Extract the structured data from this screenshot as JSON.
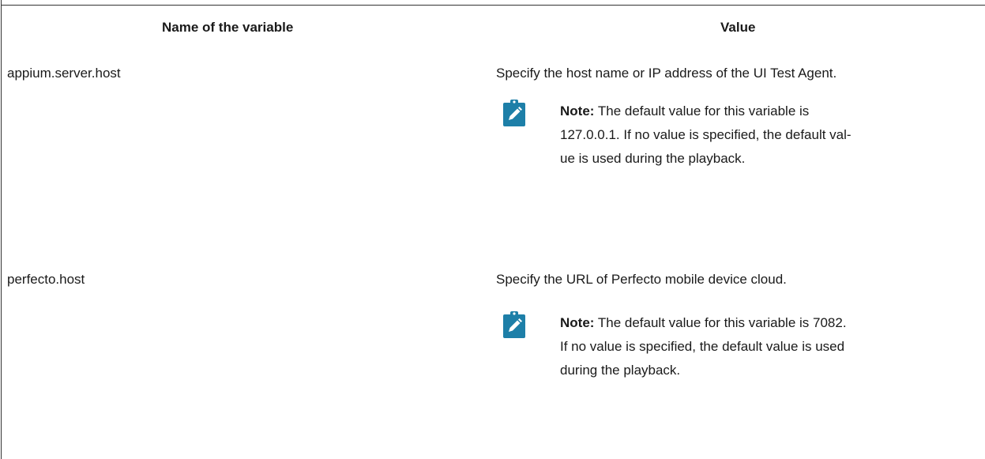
{
  "table": {
    "headers": {
      "name": "Name of the variable",
      "value": "Value"
    },
    "rows": [
      {
        "name": "appium.server.host",
        "value": "Specify the host name or IP address of the UI Test Agent.",
        "note": {
          "label": "Note:",
          "lines": [
            "The default value for this variable is",
            "127.0.0.1. If no value is specified, the default val-",
            "ue is used during the playback."
          ]
        }
      },
      {
        "name": "perfecto.host",
        "value": "Specify the URL of Perfecto mobile device cloud.",
        "note": {
          "label": "Note:",
          "lines": [
            "The default value for this variable is 7082.",
            "If no value is specified, the default value is used",
            "during the playback."
          ]
        }
      }
    ]
  },
  "colors": {
    "note_icon": "#1d7fa8",
    "border": "#333333",
    "text": "#1a1a1a"
  },
  "icons": {
    "note": "pencil-note-icon"
  }
}
